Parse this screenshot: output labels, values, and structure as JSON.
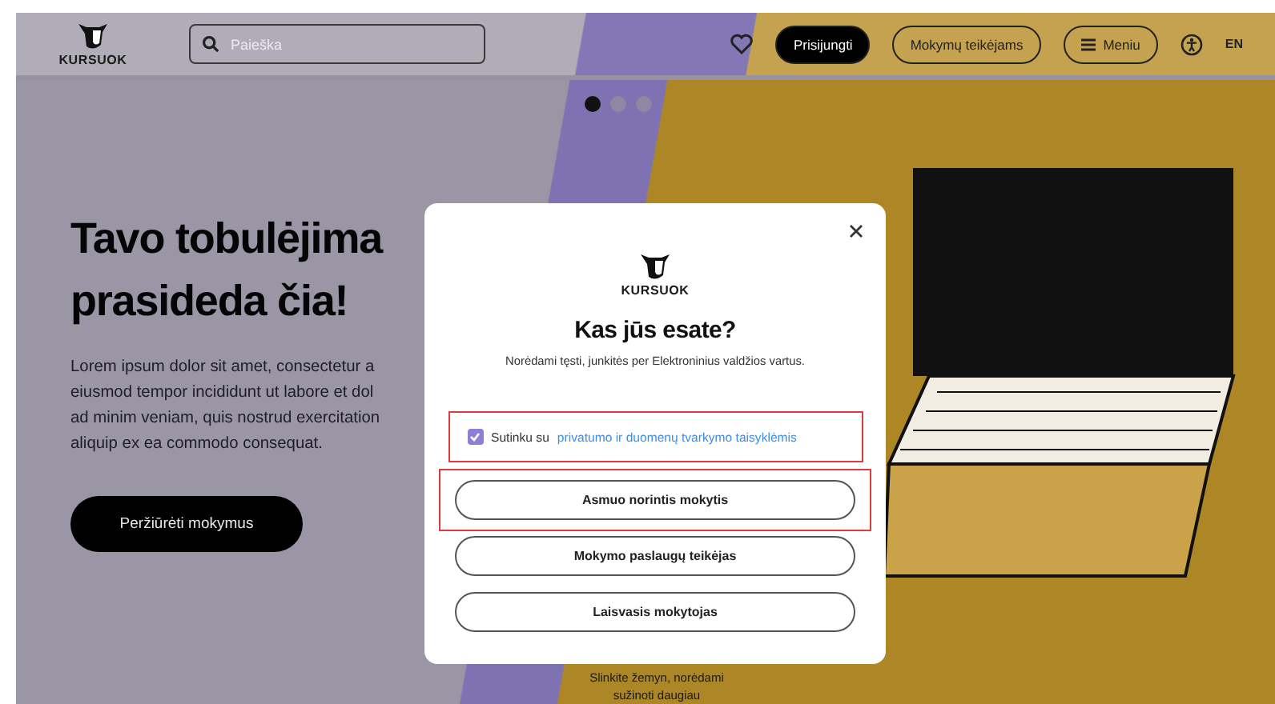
{
  "header": {
    "logo_text": "KURSUOK",
    "search": {
      "placeholder": "Paieška"
    },
    "login_button": "Prisijungti",
    "provider_button": "Mokymų teikėjams",
    "menu_button": "Meniu",
    "language": "EN"
  },
  "carousel_dots": [
    {
      "selected": true
    },
    {
      "selected": false
    },
    {
      "selected": false
    }
  ],
  "hero": {
    "title_lines": [
      "Tavo tobulėjima",
      "prasideda čia!"
    ],
    "text_lines": [
      "Lorem ipsum dolor sit amet, consectetur a",
      "eiusmod tempor incididunt ut labore et dol",
      "ad minim veniam, quis nostrud exercitation",
      "aliquip ex ea commodo consequat."
    ],
    "button": "Peržiūrėti mokymus"
  },
  "scroll_hint": [
    "Slinkite žemyn, norėdami",
    "sužinoti daugiau"
  ],
  "modal": {
    "logo_text": "KURSUOK",
    "title": "Kas jūs esate?",
    "subtitle": "Norėdami tęsti, junkitės per Elektroninius valdžios vartus.",
    "consent": {
      "checked": true,
      "highlighted": true,
      "text": "Sutinku su",
      "link": "privatumo ir duomenų tvarkymo taisyklėmis"
    },
    "options": [
      {
        "label": "Asmuo norintis mokytis",
        "highlighted": true
      },
      {
        "label": "Mokymo paslaugų teikėjas",
        "highlighted": false
      },
      {
        "label": "Laisvasis mokytojas",
        "highlighted": false
      }
    ]
  }
}
